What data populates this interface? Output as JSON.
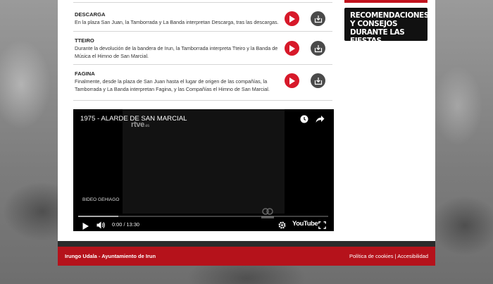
{
  "items": [
    {
      "title": "DESCARGA",
      "desc": "En la plaza San Juan, la Tamborrada y La Banda interpretan Descarga, tras las descargas."
    },
    {
      "title": "TTEIRO",
      "desc": "Durante la devolución de la bandera de Irun, la Tamborrada interpreta Tteiro y la Banda de Música el Himno de San Marcial."
    },
    {
      "title": "FAGINA",
      "desc": "Finalmente, desde la plaza de San Juan hasta el lugar de origen de las compañías, la Tamborrada y La Banda interpretan Fagina, y las Compañías el Himno de San Marcial."
    }
  ],
  "video": {
    "title": "1975 - ALARDE DE SAN MARCIAL",
    "channel_logo": "rtve",
    "channel_logo_suffix": ".es",
    "channel_label": "BIDEO GEHIAGO",
    "time_display": "0:00 / 13:30",
    "platform_label": "YouTube",
    "progress_loaded_fraction": 0.16,
    "icons": [
      "clock-icon",
      "share-icon",
      "play-icon",
      "volume-icon",
      "settings-icon",
      "fullscreen-icon"
    ]
  },
  "sidebar": {
    "recommendation_label": "RECOMENDACIONES Y CONSEJOS DURANTE LAS FIESTAS"
  },
  "footer": {
    "left_text": "Irungo Udala - Ayuntamiento de Irun",
    "cookies_link": "Política de cookies",
    "separator": "|",
    "accessibility_link": "Accesibilidad"
  },
  "colors": {
    "accent_red": "#d7192a",
    "footer_red": "#b5121b",
    "dark": "#111111"
  }
}
